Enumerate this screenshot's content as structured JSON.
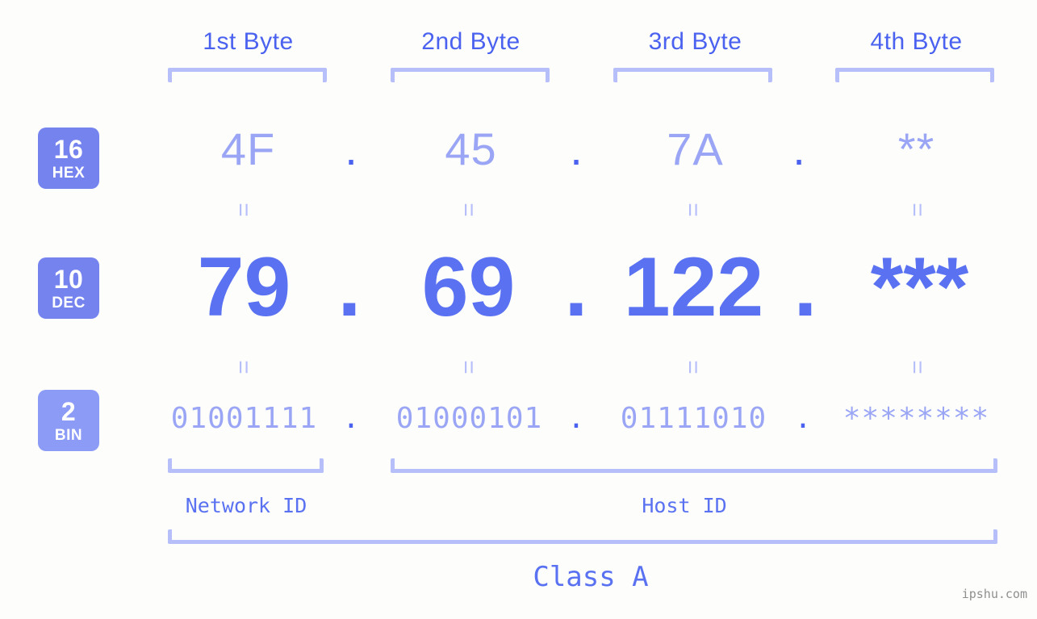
{
  "background_color": "#fdfefb",
  "accent_color": "#5a72f2",
  "accent_light": "#9aa6f5",
  "bracket_color": "#b7bffb",
  "badge_color": "#7583ef",
  "byte_headers": [
    {
      "label": "1st Byte"
    },
    {
      "label": "2nd Byte"
    },
    {
      "label": "3rd Byte"
    },
    {
      "label": "4th Byte"
    }
  ],
  "bases": [
    {
      "number": "16",
      "name": "HEX"
    },
    {
      "number": "10",
      "name": "DEC"
    },
    {
      "number": "2",
      "name": "BIN"
    }
  ],
  "rows": {
    "hex": {
      "values": [
        "4F",
        "45",
        "7A",
        "**"
      ],
      "separator": "."
    },
    "dec": {
      "values": [
        "79",
        "69",
        "122",
        "***"
      ],
      "separator": "."
    },
    "bin": {
      "values": [
        "01001111",
        "01000101",
        "01111010",
        "********"
      ],
      "separator": "."
    }
  },
  "equals_symbol": "=",
  "sections": {
    "network_id": "Network ID",
    "host_id": "Host ID",
    "class": "Class A"
  },
  "watermark": "ipshu.com"
}
